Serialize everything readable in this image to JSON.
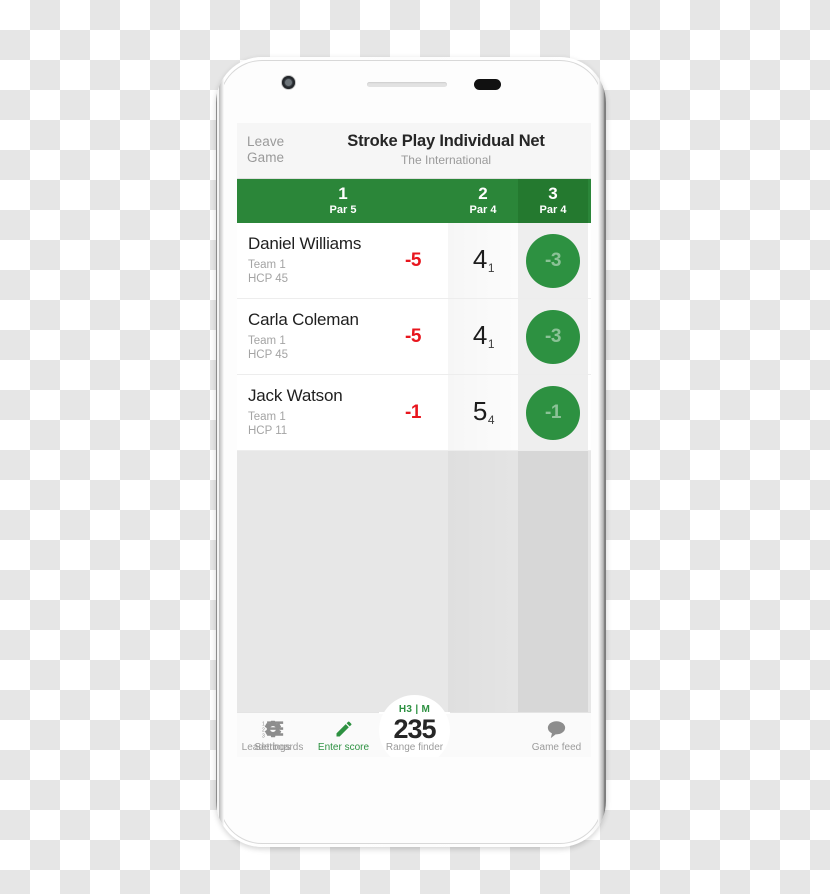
{
  "app": {
    "leave_game_label": "Leave\nGame",
    "leave_game_line1": "Leave",
    "leave_game_line2": "Game",
    "title": "Stroke Play Individual Net",
    "subtitle": "The International",
    "accent_green": "#2b8639",
    "bubble_green": "#2d9141",
    "total_red": "#e8151d"
  },
  "holes": [
    {
      "number": "1",
      "par": "Par 5"
    },
    {
      "number": "2",
      "par": "Par 4"
    },
    {
      "number": "3",
      "par": "Par 4"
    }
  ],
  "players": [
    {
      "name": "Daniel Williams",
      "team": "Team 1",
      "hcp": "HCP 45",
      "total": "-5",
      "hole2_strokes": "4",
      "hole2_net": "1",
      "hole3_bubble": "-3"
    },
    {
      "name": "Carla Coleman",
      "team": "Team 1",
      "hcp": "HCP 45",
      "total": "-5",
      "hole2_strokes": "4",
      "hole2_net": "1",
      "hole3_bubble": "-3"
    },
    {
      "name": "Jack Watson",
      "team": "Team 1",
      "hcp": "HCP 11",
      "total": "-1",
      "hole2_strokes": "5",
      "hole2_net": "4",
      "hole3_bubble": "-1"
    }
  ],
  "tabs": [
    {
      "label": "Enter score",
      "icon": "pencil-icon",
      "active": true
    },
    {
      "label": "Leaderboards",
      "icon": "numbered-list-icon",
      "active": false
    },
    {
      "label": "Game feed",
      "icon": "speech-bubble-icon",
      "active": false
    },
    {
      "label": "Settings",
      "icon": "gear-icon",
      "active": false
    }
  ],
  "rangefinder": {
    "top_label": "H3 | M",
    "value": "235",
    "label": "Range finder"
  }
}
